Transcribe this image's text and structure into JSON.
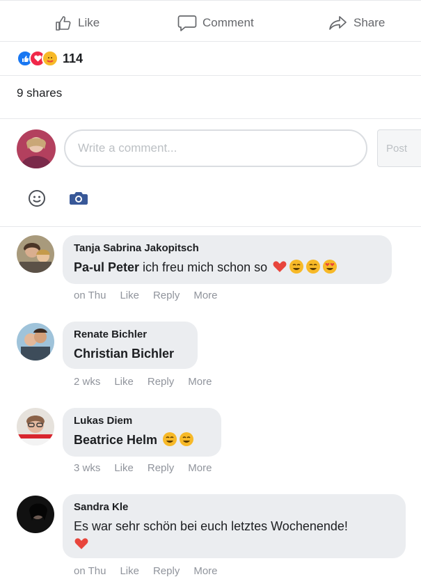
{
  "actions": {
    "like": "Like",
    "comment": "Comment",
    "share": "Share"
  },
  "reactions": {
    "count": "114",
    "types": [
      "like",
      "love",
      "care"
    ],
    "colors": {
      "like": "#1877f2",
      "love": "#f02849",
      "care": "#f7b928"
    }
  },
  "shares": "9 shares",
  "composer": {
    "placeholder": "Write a comment...",
    "post_label": "Post",
    "tools": [
      "emoji-icon",
      "camera-icon"
    ]
  },
  "comments": [
    {
      "author": "Tanja Sabrina Jakopitsch",
      "mention": "Pa-ul Peter",
      "text": " ich freu mich schon so",
      "emojis": [
        "heart",
        "grin",
        "grin",
        "heart-eyes"
      ],
      "time": "on Thu",
      "like": "Like",
      "reply": "Reply",
      "more": "More"
    },
    {
      "author": "Renate Bichler",
      "mention": "Christian Bichler",
      "text": "",
      "emojis": [],
      "time": "2 wks",
      "like": "Like",
      "reply": "Reply",
      "more": "More"
    },
    {
      "author": "Lukas Diem",
      "mention": "Beatrice Helm",
      "text": "",
      "emojis": [
        "grin",
        "grin"
      ],
      "time": "3 wks",
      "like": "Like",
      "reply": "Reply",
      "more": "More"
    },
    {
      "author": "Sandra Kle",
      "mention": "",
      "text": "Es war sehr schön bei euch letztes Wochenende!",
      "emojis": [
        "heart"
      ],
      "time": "on Thu",
      "like": "Like",
      "reply": "Reply",
      "more": "More"
    }
  ]
}
